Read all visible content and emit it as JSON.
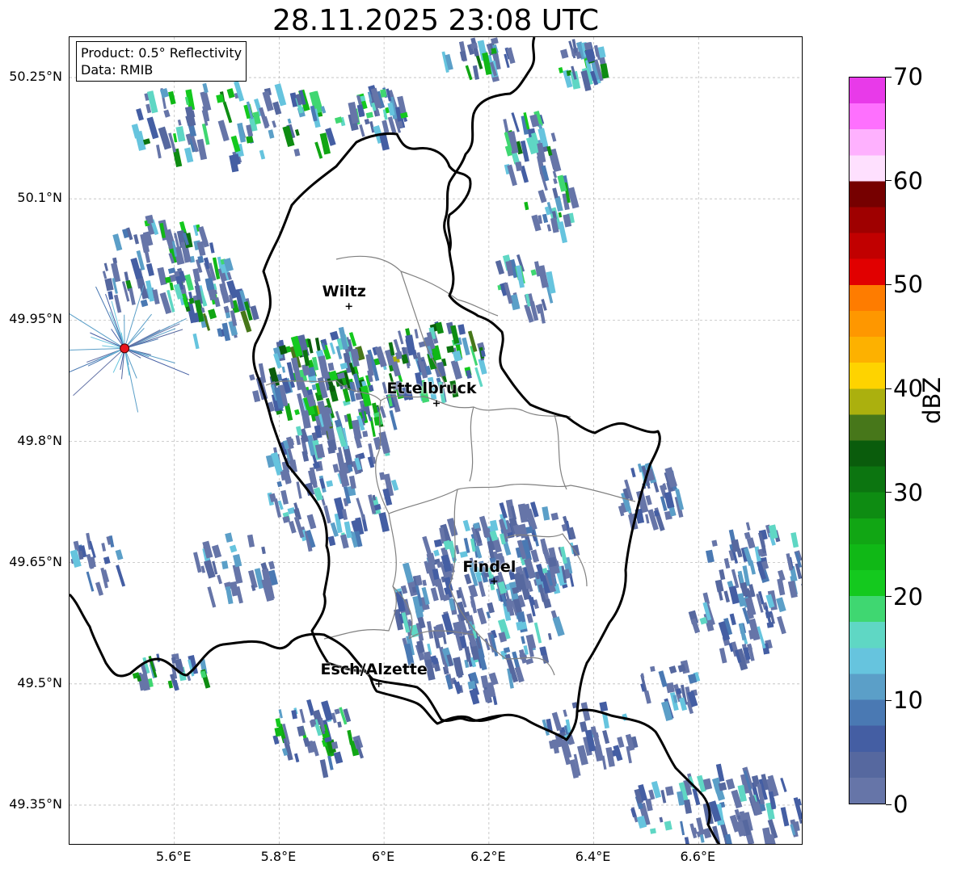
{
  "title": "28.11.2025 23:08 UTC",
  "infobox": {
    "product": "Product: 0.5° Reflectivity",
    "data": "Data: RMIB"
  },
  "axes": {
    "lat_ticks": [
      "50.25°N",
      "50.1°N",
      "49.95°N",
      "49.8°N",
      "49.65°N",
      "49.5°N",
      "49.35°N"
    ],
    "lon_ticks": [
      "5.6°E",
      "5.8°E",
      "6°E",
      "6.2°E",
      "6.4°E",
      "6.6°E"
    ],
    "lat_values": [
      50.25,
      50.1,
      49.95,
      49.8,
      49.65,
      49.5,
      49.35
    ],
    "lon_values": [
      5.6,
      5.8,
      6.0,
      6.2,
      6.4,
      6.6
    ],
    "lat_range": [
      49.3,
      50.3
    ],
    "lon_range": [
      5.4,
      6.8
    ],
    "grid": true
  },
  "cities": [
    {
      "name": "Wiltz",
      "lat": 49.967,
      "lon": 5.933
    },
    {
      "name": "Ettelbruck",
      "lat": 49.847,
      "lon": 6.1
    },
    {
      "name": "Findel",
      "lat": 49.627,
      "lon": 6.21
    },
    {
      "name": "Esch/Alzette",
      "lat": 49.5,
      "lon": 5.99
    }
  ],
  "radar_site": {
    "lat": 49.915,
    "lon": 5.505,
    "color": "#e8141c"
  },
  "colorbar": {
    "label": "dBZ",
    "min": 0,
    "max": 70,
    "ticks": [
      "0",
      "10",
      "20",
      "30",
      "40",
      "50",
      "60",
      "70"
    ],
    "tick_values": [
      0,
      10,
      20,
      30,
      40,
      50,
      60,
      70
    ],
    "colors": [
      "#6675a8",
      "#56689f",
      "#445ea3",
      "#4a79b3",
      "#5b9fc8",
      "#66c4de",
      "#5fd7c4",
      "#3fd771",
      "#14c91e",
      "#10b816",
      "#11a614",
      "#0e8c12",
      "#0c7510",
      "#0a5c0c",
      "#47771a",
      "#abb00e",
      "#fed300",
      "#fdb100",
      "#fe9700",
      "#fe7c00",
      "#e10000",
      "#c10000",
      "#9f0000",
      "#760000",
      "#fee0fe",
      "#feb1fe",
      "#fe70fe",
      "#e83ae9"
    ]
  }
}
